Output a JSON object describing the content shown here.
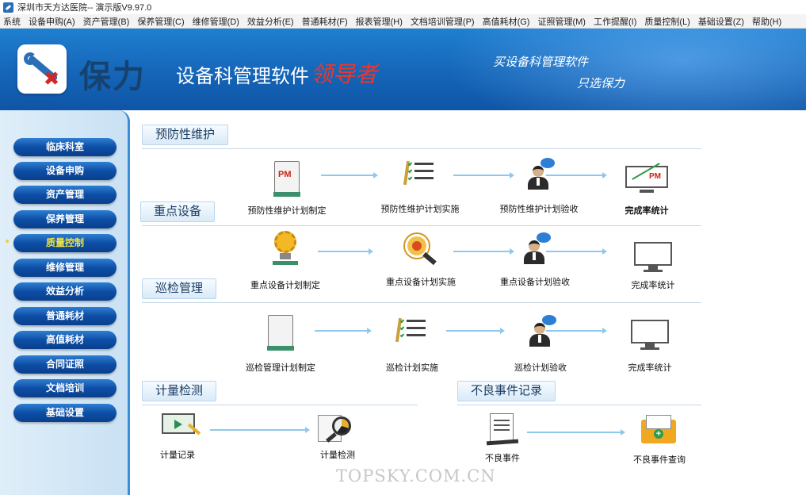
{
  "window": {
    "title": "深圳市天方达医院-- 演示版V9.97.0"
  },
  "menu": [
    "系统",
    "设备申购(A)",
    "资产管理(B)",
    "保养管理(C)",
    "维修管理(D)",
    "效益分析(E)",
    "普通耗材(F)",
    "报表管理(H)",
    "文档培训管理(P)",
    "高值耗材(G)",
    "证照管理(M)",
    "工作提醒(I)",
    "质量控制(L)",
    "基础设置(Z)",
    "帮助(H)"
  ],
  "banner": {
    "brand": "保力",
    "product": "设备科管理软件",
    "product_highlight": "领导者",
    "slogan_line1": "买设备科管理软件",
    "slogan_line2": "只选保力"
  },
  "sidebar": {
    "items": [
      "临床科室",
      "设备申购",
      "资产管理",
      "保养管理",
      "质量控制",
      "维修管理",
      "效益分析",
      "普通耗材",
      "高值耗材",
      "合同证照",
      "文档培训",
      "基础设置"
    ],
    "active": "质量控制"
  },
  "sections": {
    "preventive": {
      "title": "预防性维护",
      "items": [
        "预防性维护计划制定",
        "预防性维护计划实施",
        "预防性维护计划验收",
        "完成率统计"
      ]
    },
    "key_equipment": {
      "title": "重点设备",
      "items": [
        "重点设备计划制定",
        "重点设备计划实施",
        "重点设备计划验收",
        "完成率统计"
      ]
    },
    "inspection": {
      "title": "巡检管理",
      "items": [
        "巡检管理计划制定",
        "巡检计划实施",
        "巡检计划验收",
        "完成率统计"
      ]
    },
    "metrology": {
      "title": "计量检测",
      "items": [
        "计量记录",
        "计量检测"
      ]
    },
    "adverse": {
      "title": "不良事件记录",
      "items": [
        "不良事件",
        "不良事件查询"
      ]
    }
  },
  "icon_text": {
    "pm": "PM"
  },
  "watermark": "TOPSKY.COM.CN",
  "colors": {
    "banner": "#1565b8",
    "sidebar_button": "#0d4ea6",
    "active_text": "#f5e63a",
    "arrow": "#8fc8ec",
    "highlight_red": "#e8382e"
  }
}
